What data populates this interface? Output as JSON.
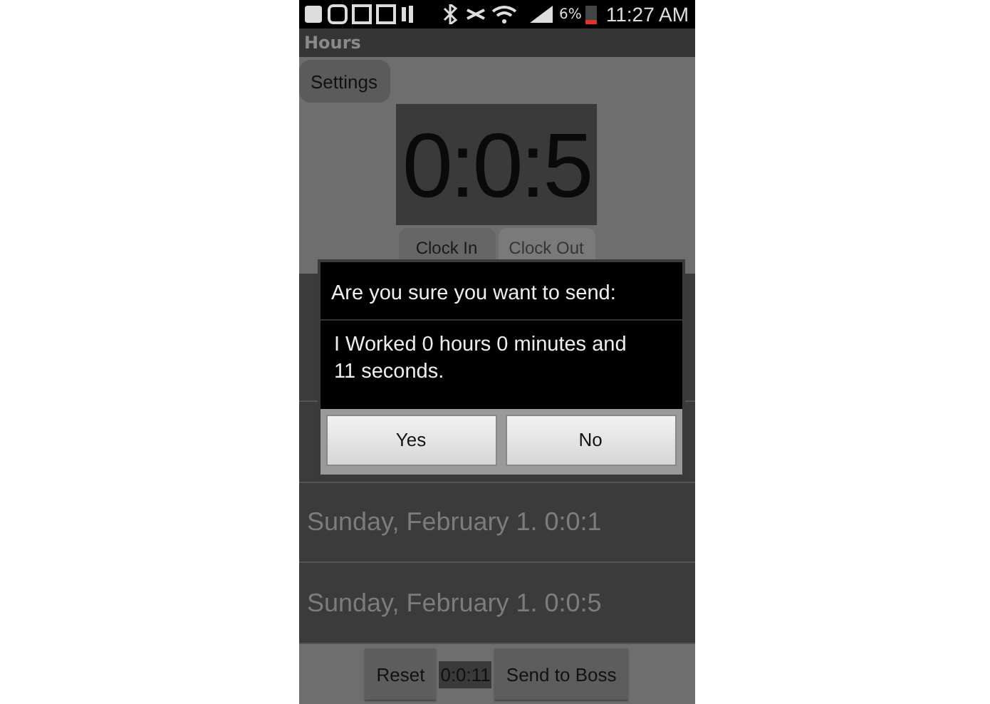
{
  "status_bar": {
    "battery": "6%",
    "time": "11:27 AM"
  },
  "window": {
    "title": "Hours"
  },
  "settings_button": "Settings",
  "clock": {
    "display": "0:0:5"
  },
  "clock_buttons": [
    {
      "label": "Clock In",
      "disabled": false
    },
    {
      "label": "Clock Out",
      "disabled": true
    }
  ],
  "entries": [
    "Sunday, February 1. 0:0:1",
    "Sunday, February 1. 0:0:5"
  ],
  "bottom_bar": {
    "reset": "Reset",
    "total": "0:0:11",
    "send": "Send to Boss"
  },
  "dialog": {
    "title": "Are you sure you want to send:",
    "message": "I Worked 0 hours 0 minutes and 11 seconds.",
    "buttons": [
      "Yes",
      "No"
    ]
  }
}
